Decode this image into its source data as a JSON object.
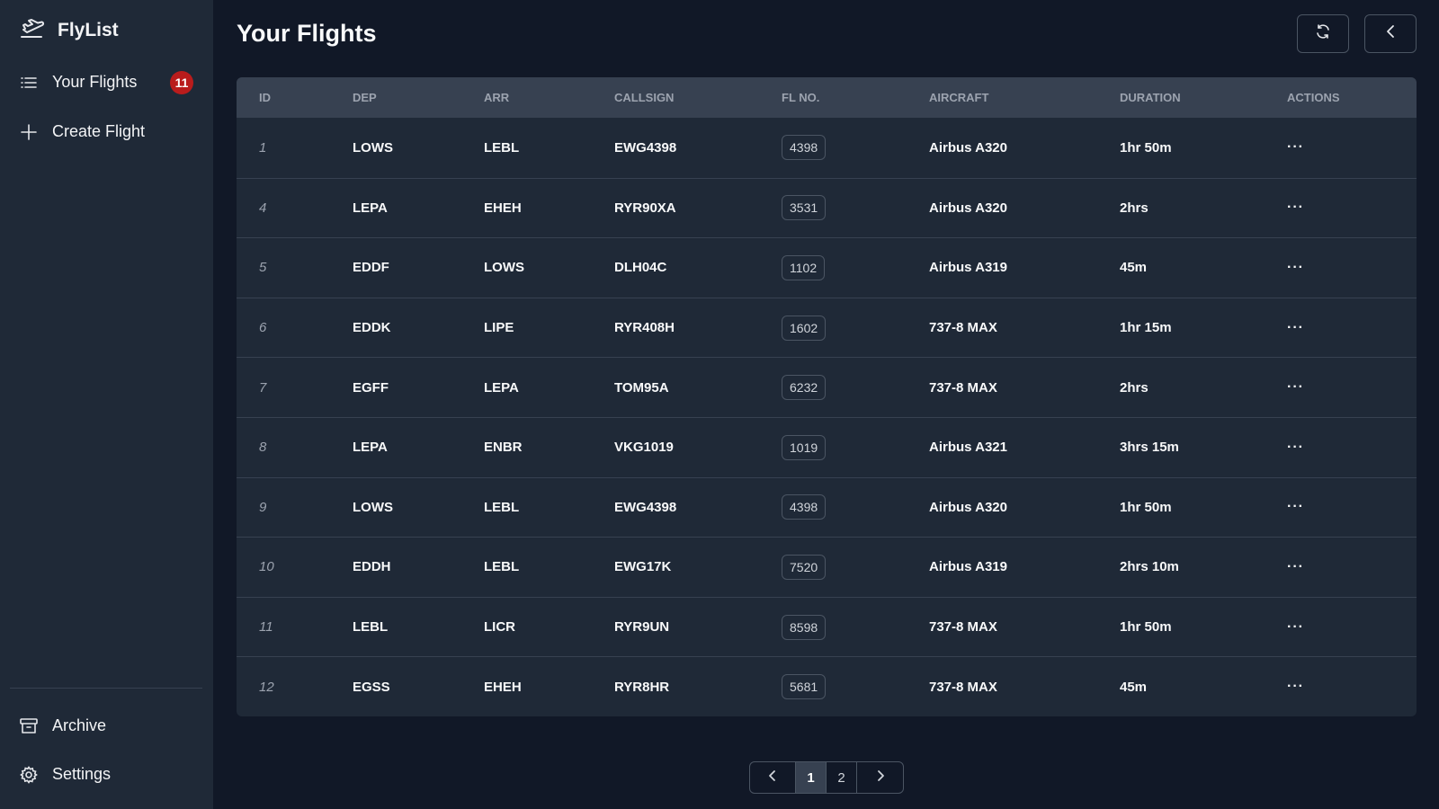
{
  "app": {
    "name": "FlyList"
  },
  "sidebar": {
    "items": [
      {
        "label": "Your Flights",
        "badge": "11",
        "icon": "list-icon"
      },
      {
        "label": "Create Flight",
        "icon": "plus-icon"
      }
    ],
    "bottom_items": [
      {
        "label": "Archive",
        "icon": "archive-icon"
      },
      {
        "label": "Settings",
        "icon": "gear-icon"
      }
    ]
  },
  "main": {
    "title": "Your Flights",
    "actions": [
      {
        "icon": "refresh-icon"
      },
      {
        "icon": "chevron-left-icon"
      }
    ]
  },
  "table": {
    "columns": [
      "ID",
      "DEP",
      "ARR",
      "CALLSIGN",
      "FL NO.",
      "AIRCRAFT",
      "DURATION",
      "ACTIONS"
    ],
    "rows": [
      {
        "id": "1",
        "dep": "LOWS",
        "arr": "LEBL",
        "callsign": "EWG4398",
        "flno": "4398",
        "aircraft": "Airbus A320",
        "duration": "1hr 50m",
        "actions": "···"
      },
      {
        "id": "4",
        "dep": "LEPA",
        "arr": "EHEH",
        "callsign": "RYR90XA",
        "flno": "3531",
        "aircraft": "Airbus A320",
        "duration": "2hrs",
        "actions": "···"
      },
      {
        "id": "5",
        "dep": "EDDF",
        "arr": "LOWS",
        "callsign": "DLH04C",
        "flno": "1102",
        "aircraft": "Airbus A319",
        "duration": "45m",
        "actions": "···"
      },
      {
        "id": "6",
        "dep": "EDDK",
        "arr": "LIPE",
        "callsign": "RYR408H",
        "flno": "1602",
        "aircraft": "737-8 MAX",
        "duration": "1hr 15m",
        "actions": "···"
      },
      {
        "id": "7",
        "dep": "EGFF",
        "arr": "LEPA",
        "callsign": "TOM95A",
        "flno": "6232",
        "aircraft": "737-8 MAX",
        "duration": "2hrs",
        "actions": "···"
      },
      {
        "id": "8",
        "dep": "LEPA",
        "arr": "ENBR",
        "callsign": "VKG1019",
        "flno": "1019",
        "aircraft": "Airbus A321",
        "duration": "3hrs 15m",
        "actions": "···"
      },
      {
        "id": "9",
        "dep": "LOWS",
        "arr": "LEBL",
        "callsign": "EWG4398",
        "flno": "4398",
        "aircraft": "Airbus A320",
        "duration": "1hr 50m",
        "actions": "···"
      },
      {
        "id": "10",
        "dep": "EDDH",
        "arr": "LEBL",
        "callsign": "EWG17K",
        "flno": "7520",
        "aircraft": "Airbus A319",
        "duration": "2hrs 10m",
        "actions": "···"
      },
      {
        "id": "11",
        "dep": "LEBL",
        "arr": "LICR",
        "callsign": "RYR9UN",
        "flno": "8598",
        "aircraft": "737-8 MAX",
        "duration": "1hr 50m",
        "actions": "···"
      },
      {
        "id": "12",
        "dep": "EGSS",
        "arr": "EHEH",
        "callsign": "RYR8HR",
        "flno": "5681",
        "aircraft": "737-8 MAX",
        "duration": "45m",
        "actions": "···"
      }
    ]
  },
  "pagination": {
    "pages": [
      "1",
      "2"
    ],
    "current": "1"
  },
  "colors": {
    "background": "#111827",
    "sidebar": "#1f2937",
    "badge": "#b91c1c",
    "header_row": "#374151"
  }
}
